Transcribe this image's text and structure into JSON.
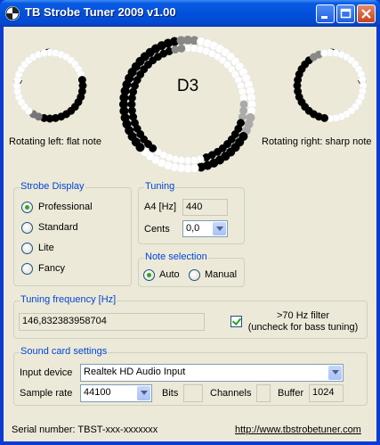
{
  "window": {
    "title": "TB Strobe Tuner 2009 v1.00"
  },
  "strobe": {
    "note": "D3",
    "left_caption": "Rotating left: flat note",
    "right_caption": "Rotating right: sharp note"
  },
  "strobe_display": {
    "title": "Strobe Display",
    "options": [
      "Professional",
      "Standard",
      "Lite",
      "Fancy"
    ],
    "selected": "Professional"
  },
  "tuning": {
    "title": "Tuning",
    "a4_label": "A4 [Hz]",
    "a4_value": "440",
    "cents_label": "Cents",
    "cents_value": "0,0"
  },
  "note_selection": {
    "title": "Note selection",
    "auto_label": "Auto",
    "manual_label": "Manual",
    "selected": "Auto"
  },
  "tuning_frequency": {
    "title": "Tuning frequency [Hz]",
    "value": "146,832383958704",
    "filter_line1": ">70 Hz filter",
    "filter_line2": "(uncheck for bass tuning)",
    "filter_checked": true
  },
  "sound_card": {
    "title": "Sound card settings",
    "input_device_label": "Input device",
    "input_device_value": "Realtek HD Audio Input",
    "sample_rate_label": "Sample rate",
    "sample_rate_value": "44100",
    "bits_label": "Bits",
    "channels_label": "Channels",
    "buffer_label": "Buffer",
    "buffer_value": "1024"
  },
  "footer": {
    "serial": "Serial number: TBST-xxx-xxxxxxx",
    "url": "http://www.tbstrobetuner.com"
  }
}
